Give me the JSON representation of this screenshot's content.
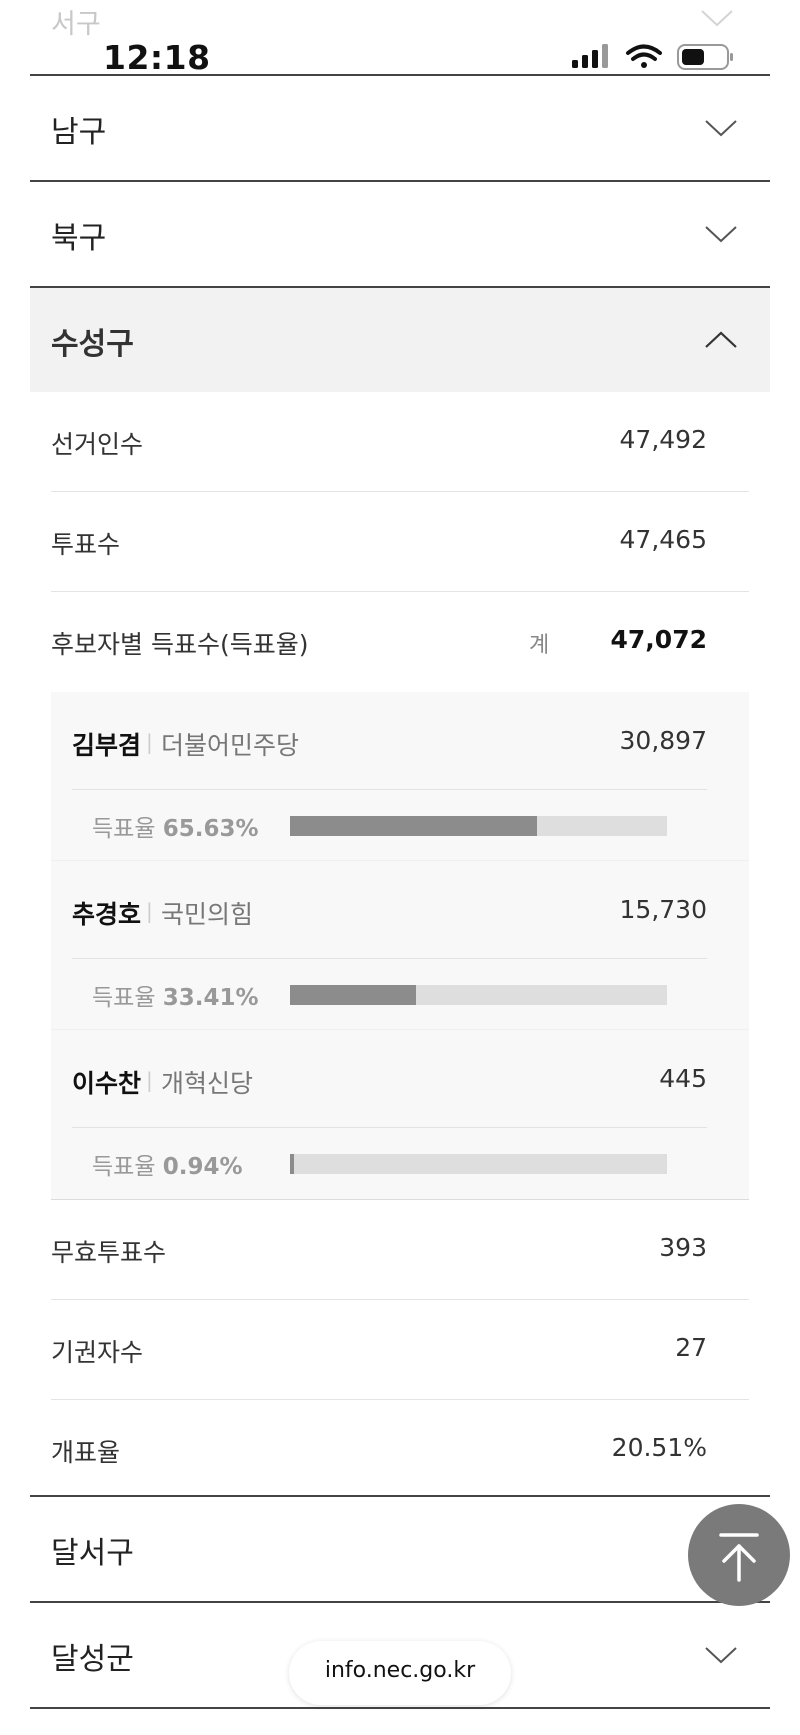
{
  "status_bar": {
    "time": "12:18"
  },
  "faded_district": {
    "label": "서구"
  },
  "districts_top": [
    {
      "label": "남구"
    },
    {
      "label": "북구"
    }
  ],
  "open_district": {
    "label": "수성구",
    "electorate_label": "선거인수",
    "electorate_value": "47,492",
    "turnout_label": "투표수",
    "turnout_value": "47,465",
    "candidate_votes_label": "후보자별 득표수(득표율)",
    "sum_label": "계",
    "sum_value": "47,072",
    "rate_prefix": "득표율",
    "candidates": [
      {
        "name": "김부겸",
        "party": "더불어민주당",
        "votes": "30,897",
        "rate": "65.63%",
        "rate_value": 65.63
      },
      {
        "name": "추경호",
        "party": "국민의힘",
        "votes": "15,730",
        "rate": "33.41%",
        "rate_value": 33.41
      },
      {
        "name": "이수찬",
        "party": "개혁신당",
        "votes": "445",
        "rate": "0.94%",
        "rate_value": 0.94
      }
    ],
    "invalid_label": "무효투표수",
    "invalid_value": "393",
    "abstain_label": "기권자수",
    "abstain_value": "27",
    "count_rate_label": "개표율",
    "count_rate_value": "20.51%"
  },
  "districts_bottom": [
    {
      "label": "달서구"
    },
    {
      "label": "달성군"
    }
  ],
  "url_bar": {
    "text": "info.nec.go.kr"
  },
  "icons": {
    "chevron": "chevron-down-icon",
    "scroll_top": "arrow-up-to-top-icon"
  },
  "colors": {
    "bar_fill": "#8c8c8c",
    "bar_track": "#dedede",
    "open_header_bg": "#f2f2f2"
  }
}
